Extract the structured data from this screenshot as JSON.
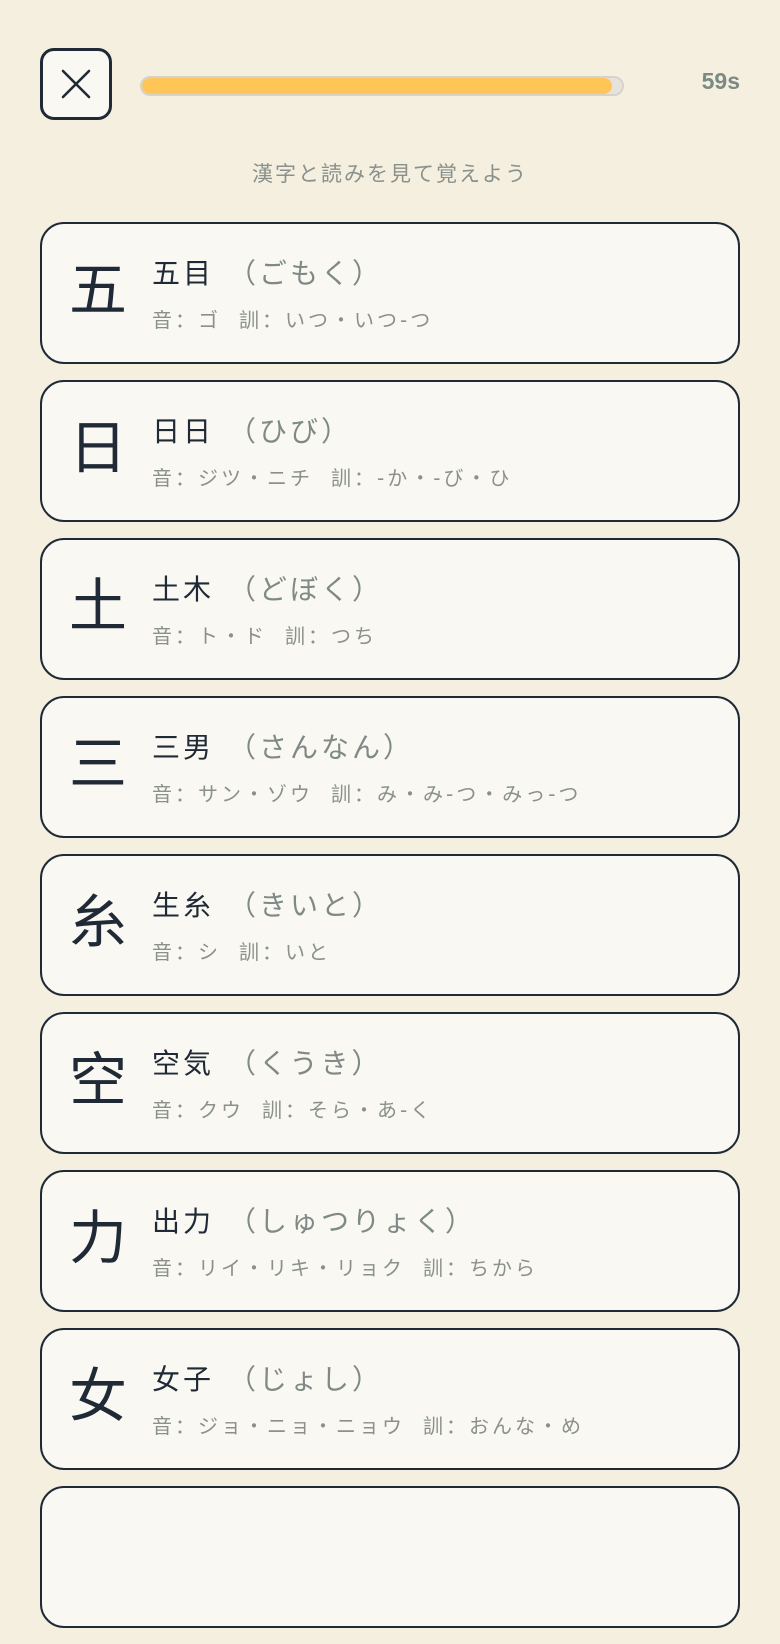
{
  "header": {
    "close_icon": "close-icon",
    "progress": 0.98,
    "timer": "59s"
  },
  "instruction": "漢字と読みを見て覚えよう",
  "colors": {
    "background": "#f5efe0",
    "progress_fill": "#ffc557",
    "card_border": "#1f2a36"
  },
  "cards": [
    {
      "kanji": "五",
      "word": "五目",
      "reading": "（ごもく）",
      "on": "音：ゴ",
      "kun": "訓：いつ・いつ-つ"
    },
    {
      "kanji": "日",
      "word": "日日",
      "reading": "（ひび）",
      "on": "音：ジツ・ニチ",
      "kun": "訓：-か・-び・ひ"
    },
    {
      "kanji": "土",
      "word": "土木",
      "reading": "（どぼく）",
      "on": "音：ト・ド",
      "kun": "訓：つち"
    },
    {
      "kanji": "三",
      "word": "三男",
      "reading": "（さんなん）",
      "on": "音：サン・ゾウ",
      "kun": "訓：み・み-つ・みっ-つ"
    },
    {
      "kanji": "糸",
      "word": "生糸",
      "reading": "（きいと）",
      "on": "音：シ",
      "kun": "訓：いと"
    },
    {
      "kanji": "空",
      "word": "空気",
      "reading": "（くうき）",
      "on": "音：クウ",
      "kun": "訓：そら・あ-く"
    },
    {
      "kanji": "力",
      "word": "出力",
      "reading": "（しゅつりょく）",
      "on": "音：リイ・リキ・リョク",
      "kun": "訓：ちから"
    },
    {
      "kanji": "女",
      "word": "女子",
      "reading": "（じょし）",
      "on": "音：ジョ・ニョ・ニョウ",
      "kun": "訓：おんな・め"
    }
  ]
}
